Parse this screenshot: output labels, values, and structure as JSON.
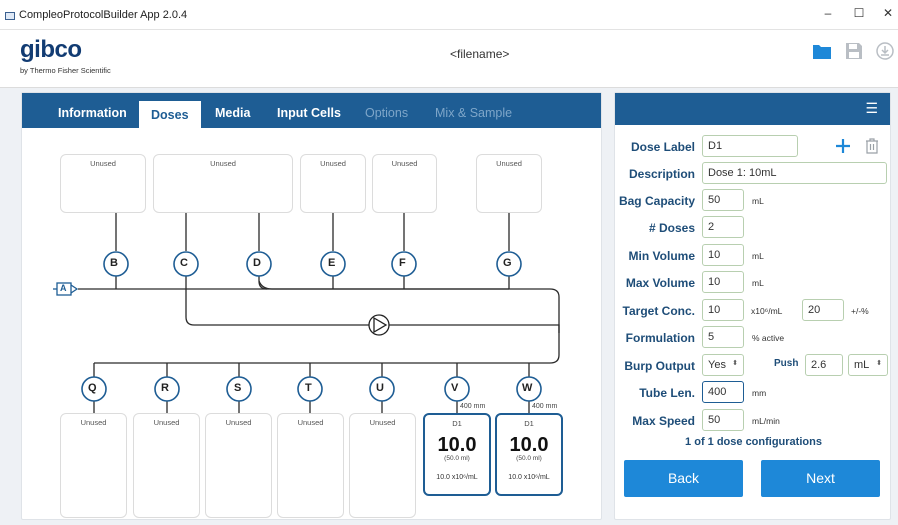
{
  "window": {
    "title": "CompleoProtocolBuilder App 2.0.4",
    "minimize": "–",
    "maximize": "☐",
    "close": "✕"
  },
  "header": {
    "logo": "gibco",
    "logo_sub": "by Thermo Fisher Scientific",
    "filename": "<filename>"
  },
  "tabs": [
    {
      "label": "Information",
      "state": "normal"
    },
    {
      "label": "Doses",
      "state": "active"
    },
    {
      "label": "Media",
      "state": "normal"
    },
    {
      "label": "Input Cells",
      "state": "normal"
    },
    {
      "label": "Options",
      "state": "disabled"
    },
    {
      "label": "Mix & Sample",
      "state": "disabled"
    }
  ],
  "diagram": {
    "input_node": "A",
    "top_ports": [
      "B",
      "C",
      "D",
      "E",
      "F",
      "G"
    ],
    "top_boxes": [
      "Unused",
      "Unused",
      "Unused",
      "Unused",
      "Unused"
    ],
    "bottom_ports": [
      "Q",
      "R",
      "S",
      "T",
      "U",
      "V",
      "W"
    ],
    "bottom_boxes": [
      "Unused",
      "Unused",
      "Unused",
      "Unused",
      "Unused"
    ],
    "tube_lengths": {
      "V": "400 mm",
      "W": "400 mm"
    },
    "dose_cards": [
      {
        "label": "D1",
        "volume": "10.0",
        "sub": "(50.0 ml)",
        "conc": "10.0 x10⁶/mL"
      },
      {
        "label": "D1",
        "volume": "10.0",
        "sub": "(50.0 ml)",
        "conc": "10.0 x10⁶/mL"
      }
    ]
  },
  "form": {
    "menu_icon": "☰",
    "dose_label": {
      "label": "Dose Label",
      "value": "D1"
    },
    "description": {
      "label": "Description",
      "value": "Dose 1: 10mL"
    },
    "bag_capacity": {
      "label": "Bag Capacity",
      "value": "50",
      "unit": "mL"
    },
    "num_doses": {
      "label": "# Doses",
      "value": "2"
    },
    "min_volume": {
      "label": "Min Volume",
      "value": "10",
      "unit": "mL"
    },
    "max_volume": {
      "label": "Max Volume",
      "value": "10",
      "unit": "mL"
    },
    "target_conc": {
      "label": "Target Conc.",
      "value": "10",
      "unit": "x10⁶/mL",
      "tolerance": "20",
      "tol_unit": "+/-%"
    },
    "formulation": {
      "label": "Formulation",
      "value": "5",
      "unit": "% active"
    },
    "burp_output": {
      "label": "Burp Output",
      "value": "Yes",
      "push_label": "Push",
      "push_value": "2.6",
      "push_unit": "mL"
    },
    "tube_len": {
      "label": "Tube Len.",
      "value": "400",
      "unit": "mm"
    },
    "max_speed": {
      "label": "Max Speed",
      "value": "50",
      "unit": "mL/min"
    },
    "config_count": "1 of 1 dose configurations",
    "back": "Back",
    "next": "Next"
  }
}
